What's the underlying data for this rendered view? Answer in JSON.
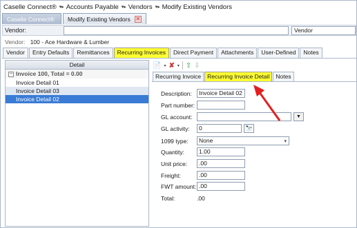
{
  "breadcrumb": [
    "Caselle Connect®",
    "Accounts Payable",
    "Vendors",
    "Modify Existing Vendors"
  ],
  "breadcrumb_sep": "▾ ▸",
  "doc_tabs": [
    {
      "label": "Caselle Connect®",
      "active": false
    },
    {
      "label": "Modify Existing Vendors",
      "active": true,
      "close": "✕"
    }
  ],
  "vendor_search": {
    "label": "Vendor:",
    "value": "",
    "dropdown_value": "Vendor"
  },
  "vendor_info": {
    "label": "Vendor:",
    "number": "100",
    "sep": "-",
    "name": "Ace Hardware & Lumber"
  },
  "main_tabs": [
    "Vendor",
    "Entry Defaults",
    "Remittances",
    "Recurring Invoices",
    "Direct Payment",
    "Attachments",
    "User-Defined",
    "Notes"
  ],
  "active_main_tab": "Recurring Invoices",
  "left_panel": {
    "header": "Detail",
    "group": "Invoice 100, Total = 0.00",
    "group_toggle": "−",
    "items": [
      "Invoice Detail 01",
      "Invoice Detail 03",
      "Invoice Detail 02"
    ],
    "selected": "Invoice Detail 02"
  },
  "toolbar": {
    "new_icon": "document-icon",
    "delete_icon": "delete-icon",
    "up_icon": "arrow-up-icon",
    "down_icon": "arrow-down-icon",
    "new_glyph": "📄",
    "delete_glyph": "✘",
    "up_glyph": "⇧",
    "down_glyph": "⇩",
    "caret": "▾"
  },
  "sub_tabs": [
    "Recurring Invoice",
    "Recurring Invoice Detail",
    "Notes"
  ],
  "active_sub_tab": "Recurring Invoice Detail",
  "form": {
    "description": {
      "label": "Description:",
      "value": "Invoice Detail 02"
    },
    "part_number": {
      "label": "Part number:",
      "value": ""
    },
    "gl_account": {
      "label": "GL account:",
      "value": "",
      "button": "▼"
    },
    "gl_activity": {
      "label": "GL activity:",
      "value": "0",
      "button": "🔭"
    },
    "type_1099": {
      "label": "1099 type:",
      "value": "None",
      "arrow": "▾"
    },
    "quantity": {
      "label": "Quantity:",
      "value": "1.00"
    },
    "unit_price": {
      "label": "Unit price:",
      "value": ".00"
    },
    "freight": {
      "label": "Freight:",
      "value": ".00"
    },
    "fwt_amount": {
      "label": "FWT amount:",
      "value": ".00"
    },
    "total": {
      "label": "Total:",
      "value": ".00"
    }
  },
  "colors": {
    "highlight": "#ffff33",
    "selection": "#3a7bd5",
    "annotation_arrow": "#e41e1e"
  }
}
